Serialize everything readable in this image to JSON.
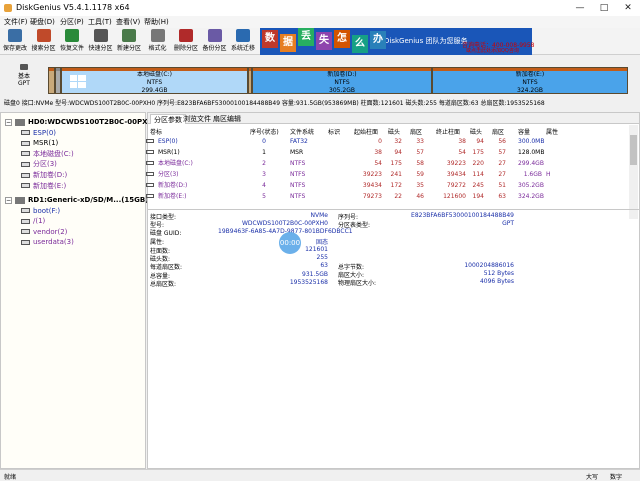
{
  "window": {
    "title": "DiskGenius V5.4.1.1178 x64"
  },
  "menu": [
    "文件(F)",
    "硬盘(D)",
    "分区(P)",
    "工具(T)",
    "查看(V)",
    "帮助(H)"
  ],
  "toolbar": [
    {
      "label": "保存更改",
      "icon": "save-icon",
      "color": "#3a6ea5"
    },
    {
      "label": "搜索分区",
      "icon": "search-partition-icon",
      "color": "#c04a2a"
    },
    {
      "label": "恢复文件",
      "icon": "recover-files-icon",
      "color": "#2a8a3a"
    },
    {
      "label": "快速分区",
      "icon": "quick-partition-icon",
      "color": "#555555"
    },
    {
      "label": "新建分区",
      "icon": "new-partition-icon",
      "color": "#4a7a4a"
    },
    {
      "label": "格式化",
      "icon": "format-icon",
      "color": "#777777"
    },
    {
      "label": "删除分区",
      "icon": "delete-partition-icon",
      "color": "#b02a2a"
    },
    {
      "label": "备份分区",
      "icon": "backup-partition-icon",
      "color": "#6a5aa5"
    },
    {
      "label": "系统迁移",
      "icon": "system-migration-icon",
      "color": "#2a6ab0"
    }
  ],
  "banner": {
    "chars": [
      "数",
      "据",
      "丢",
      "失",
      "怎",
      "么",
      "办"
    ],
    "colors": [
      "#c0392b",
      "#e67e22",
      "#27ae60",
      "#8e44ad",
      "#d35400",
      "#16a085",
      "#2980b9"
    ],
    "slogan": "DiskGenius 团队为您服务",
    "phone": "咨询电话：400-008-9958",
    "qq": "或点击此处添加QQ咨询"
  },
  "diskmap": {
    "left_top": "基本",
    "left_bottom": "GPT",
    "partitions": [
      {
        "name": "本地磁盘(C:)",
        "fs": "NTFS",
        "size": "299.4GB",
        "color": "#b0d8f8"
      },
      {
        "name": "新加卷(D:)",
        "fs": "NTFS",
        "size": "305.2GB",
        "color": "#4aa3ea"
      },
      {
        "name": "新加卷(E:)",
        "fs": "NTFS",
        "size": "324.2GB",
        "color": "#4aa3ea"
      }
    ]
  },
  "diskinfo": "磁盘0 接口:NVMe  型号:WDCWDS100T2B0C-00PXH0  序列号:E823BFA6BF53000100184488B49  容量:931.5GB(953869MB)  柱面数:121601  磁头数:255  每道扇区数:63  总扇区数:1953525168",
  "tree": [
    {
      "label": "HD0:WDCWDS100T2B0C-00PXH0(93",
      "level": 0,
      "type": "disk",
      "color": "#000000"
    },
    {
      "label": "ESP(0)",
      "level": 1,
      "type": "part",
      "color": "#1a2fa8"
    },
    {
      "label": "MSR(1)",
      "level": 1,
      "type": "part",
      "color": "#000000"
    },
    {
      "label": "本地磁盘(C:)",
      "level": 1,
      "type": "part",
      "color": "#7a2a9a"
    },
    {
      "label": "分区(3)",
      "level": 1,
      "type": "part",
      "color": "#7a2a9a"
    },
    {
      "label": "新加卷(D:)",
      "level": 1,
      "type": "part",
      "color": "#7a2a9a"
    },
    {
      "label": "新加卷(E:)",
      "level": 1,
      "type": "part",
      "color": "#7a2a9a"
    },
    {
      "label": "RD1:Generic-xD/SD/M...(15GB)",
      "level": 0,
      "type": "disk",
      "color": "#000000"
    },
    {
      "label": "boot(F:)",
      "level": 1,
      "type": "part",
      "color": "#1a2fa8"
    },
    {
      "label": "/(1)",
      "level": 1,
      "type": "part",
      "color": "#7a2a9a"
    },
    {
      "label": "vendor(2)",
      "level": 1,
      "type": "part",
      "color": "#7a2a9a"
    },
    {
      "label": "userdata(3)",
      "level": 1,
      "type": "part",
      "color": "#7a2a9a"
    }
  ],
  "tabs": [
    "分区参数",
    "浏览文件",
    "扇区编辑"
  ],
  "table": {
    "headers": [
      "卷标",
      "序号(状态)",
      "文件系统",
      "标识",
      "起始柱面",
      "磁头",
      "扇区",
      "终止柱面",
      "磁头",
      "扇区",
      "容量",
      "属性"
    ],
    "rows": [
      {
        "cells": [
          "ESP(0)",
          "0",
          "FAT32",
          "",
          "0",
          "32",
          "33",
          "38",
          "94",
          "56",
          "300.0MB",
          ""
        ],
        "color": "#1a2fa8"
      },
      {
        "cells": [
          "MSR(1)",
          "1",
          "MSR",
          "",
          "38",
          "94",
          "57",
          "54",
          "175",
          "57",
          "128.0MB",
          ""
        ],
        "color": "#000000"
      },
      {
        "cells": [
          "本地磁盘(C:)",
          "2",
          "NTFS",
          "",
          "54",
          "175",
          "58",
          "39223",
          "220",
          "27",
          "299.4GB",
          ""
        ],
        "color": "#7a2a9a"
      },
      {
        "cells": [
          "分区(3)",
          "3",
          "NTFS",
          "",
          "39223",
          "241",
          "59",
          "39434",
          "114",
          "27",
          "1.6GB",
          "H"
        ],
        "color": "#7a2a9a"
      },
      {
        "cells": [
          "新加卷(D:)",
          "4",
          "NTFS",
          "",
          "39434",
          "172",
          "35",
          "79272",
          "245",
          "51",
          "305.2GB",
          ""
        ],
        "color": "#7a2a9a"
      },
      {
        "cells": [
          "新加卷(E:)",
          "5",
          "NTFS",
          "",
          "79273",
          "22",
          "46",
          "121600",
          "194",
          "63",
          "324.2GB",
          ""
        ],
        "color": "#7a2a9a"
      }
    ]
  },
  "details": {
    "left": [
      {
        "label": "接口类型:",
        "value": "NVMe"
      },
      {
        "label": "型号:",
        "value": "WDCWDS100T2B0C-00PXH0"
      },
      {
        "label": "磁盘 GUID:",
        "value": "19B9463F-6A85-4A7D-9877-801BDF6DBCC1"
      },
      {
        "label": "属性:",
        "value": "固态"
      }
    ],
    "right": [
      {
        "label": "序列号:",
        "value": "E823BFA6BF53000100184488B49"
      },
      {
        "label": "分区表类型:",
        "value": "GPT"
      }
    ],
    "geo_left": [
      {
        "label": "柱面数:",
        "value": "121601"
      },
      {
        "label": "磁头数:",
        "value": "255"
      },
      {
        "label": "每道扇区数:",
        "value": "63"
      },
      {
        "label": "总容量:",
        "value": "931.5GB"
      },
      {
        "label": "总扇区数:",
        "value": "1953525168"
      }
    ],
    "geo_right": [
      {
        "label": "总字节数:",
        "value": "1000204886016"
      },
      {
        "label": "扇区大小:",
        "value": "512 Bytes"
      },
      {
        "label": "物理扇区大小:",
        "value": "4096 Bytes"
      }
    ]
  },
  "overlay": {
    "time": "00:00"
  },
  "status": {
    "left": "就绪",
    "caps": "大写",
    "num": "数字"
  }
}
